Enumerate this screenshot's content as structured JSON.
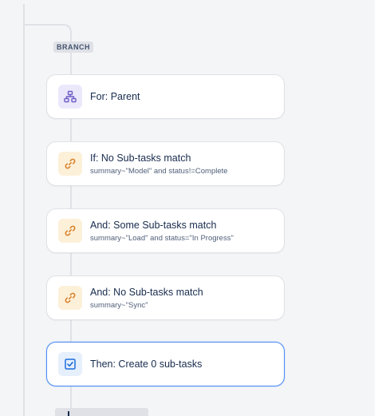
{
  "branch": {
    "badge": "BRANCH"
  },
  "components": [
    {
      "title": "For: Parent",
      "subtitle": "",
      "icon": "branch-hierarchy-icon",
      "type": "branch"
    },
    {
      "title": "If: No Sub-tasks match",
      "subtitle": "summary~\"Model\" and status!=Complete",
      "icon": "link-icon",
      "type": "condition"
    },
    {
      "title": "And: Some Sub-tasks match",
      "subtitle": "summary~\"Load\" and status=\"In Progress\"",
      "icon": "link-icon",
      "type": "condition"
    },
    {
      "title": "And: No Sub-tasks match",
      "subtitle": "summary~\"Sync\"",
      "icon": "link-icon",
      "type": "condition"
    },
    {
      "title": "Then: Create 0 sub-tasks",
      "subtitle": "",
      "icon": "checkbox-icon",
      "type": "action",
      "selected": true
    }
  ],
  "colors": {
    "branch_icon": "#6e5dc6",
    "condition_icon": "#d9822b",
    "action_icon": "#1d6fdc",
    "selected_border": "#4c8cf5"
  }
}
